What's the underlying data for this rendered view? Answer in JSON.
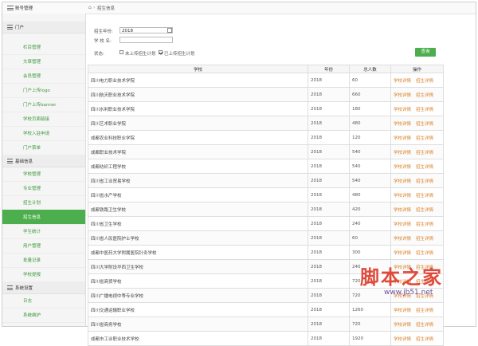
{
  "sidebar": {
    "corner_title": "账号管理",
    "groups": [
      {
        "label": "门户",
        "items": [
          "栏目管理",
          "文章管理",
          "会员管理",
          "门户上传logo",
          "门户上传banner",
          "学校页面链接",
          "学校入驻申请",
          "门户菜单"
        ]
      },
      {
        "label": "基础信息",
        "items": [
          "学校管理",
          "专业管理",
          "招生计划",
          "招生信息",
          "学生统计",
          "用户管理",
          "批量记录",
          "学校提报"
        ]
      },
      {
        "label": "系统设置",
        "items": [
          "日志",
          "系统维护"
        ]
      }
    ],
    "active_item": "招生信息"
  },
  "topbar": {
    "home_icon": "home-icon",
    "breadcrumb": "招生信息"
  },
  "filters": {
    "year_label": "招生年份:",
    "year_value": "2018",
    "school_label": "学 校 名:",
    "school_value": "",
    "status_label": "状态:",
    "opt_unuploaded": "未上传招生计划",
    "opt_uploaded": "已上传招生计划",
    "opt_unuploaded_checked": false,
    "opt_uploaded_checked": true,
    "search_label": "查询"
  },
  "table": {
    "headers": [
      "学校",
      "年份",
      "总人数",
      "操作"
    ],
    "action_labels": [
      "学校详情",
      "招生详情"
    ],
    "rows": [
      {
        "school": "四川电力职业技术学院",
        "year": "2018",
        "count": "60"
      },
      {
        "school": "四川航天职业技术学院",
        "year": "2018",
        "count": "660"
      },
      {
        "school": "四川水利职业技术学院",
        "year": "2018",
        "count": "180"
      },
      {
        "school": "四川艺术职业学院",
        "year": "2018",
        "count": "480"
      },
      {
        "school": "成都农业科技职业学院",
        "year": "2018",
        "count": "120"
      },
      {
        "school": "成都职业技术学院",
        "year": "2018",
        "count": "540"
      },
      {
        "school": "成都纺织工程学校",
        "year": "2018",
        "count": "540"
      },
      {
        "school": "四川省工业贸易学校",
        "year": "2018",
        "count": "540"
      },
      {
        "school": "四川省水产学校",
        "year": "2018",
        "count": "480"
      },
      {
        "school": "成都铁路卫生学校",
        "year": "2018",
        "count": "420"
      },
      {
        "school": "四川省卫生学校",
        "year": "2018",
        "count": "240"
      },
      {
        "school": "四川省人民医院护士学校",
        "year": "2018",
        "count": "60"
      },
      {
        "school": "成都中医药大学附属医院针灸学校",
        "year": "2018",
        "count": "300"
      },
      {
        "school": "四川大学附设华西卫生学校",
        "year": "2018",
        "count": "240"
      },
      {
        "school": "四川省商贸学校",
        "year": "2018",
        "count": "720"
      },
      {
        "school": "四川广播电视中等专业学校",
        "year": "2018",
        "count": "720"
      },
      {
        "school": "四川交通运输职业学校",
        "year": "2018",
        "count": "1260"
      },
      {
        "school": "四川省商务学校",
        "year": "2018",
        "count": "720"
      },
      {
        "school": "成都市工业职业技术学校",
        "year": "2018",
        "count": "1920"
      }
    ]
  },
  "watermark": {
    "main": "脚本之家",
    "sub": "www.jb51.net"
  }
}
